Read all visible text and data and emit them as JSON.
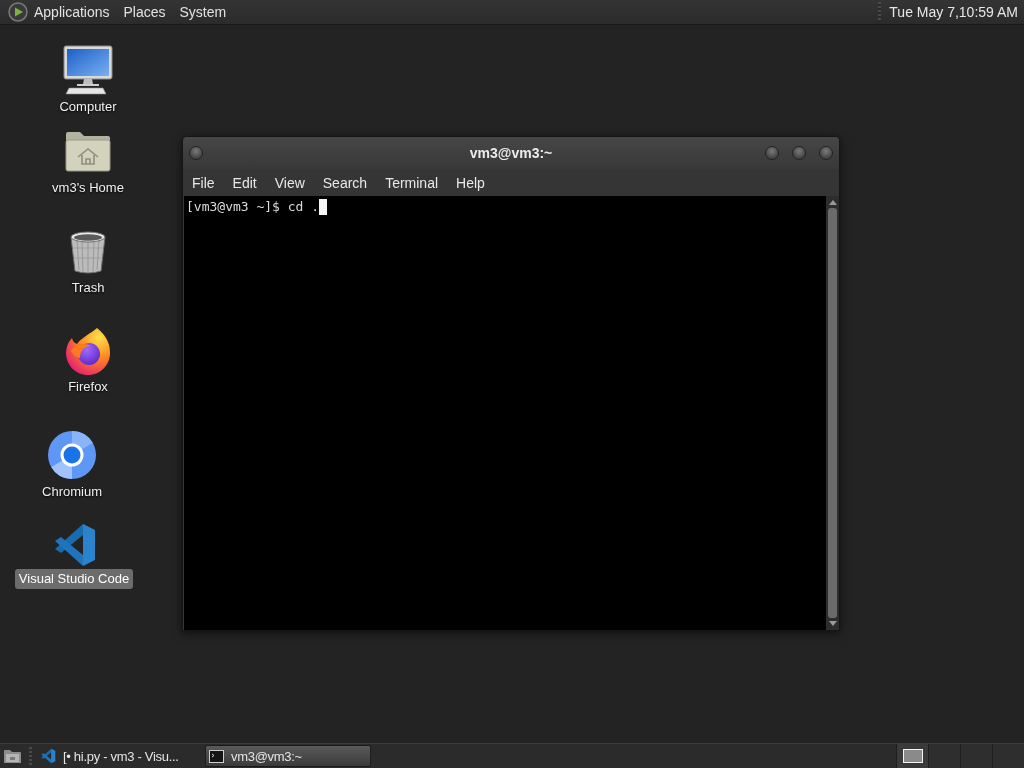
{
  "top_panel": {
    "menus": [
      "Applications",
      "Places",
      "System"
    ],
    "clock": "Tue May 7,10:59 AM"
  },
  "desktop_icons": [
    {
      "label": "Computer",
      "kind": "computer",
      "selected": false
    },
    {
      "label": "vm3's Home",
      "kind": "home",
      "selected": false
    },
    {
      "label": "Trash",
      "kind": "trash",
      "selected": false
    },
    {
      "label": "Firefox",
      "kind": "firefox",
      "selected": false
    },
    {
      "label": "Chromium",
      "kind": "chromium",
      "selected": false
    },
    {
      "label": "Visual Studio Code",
      "kind": "vscode",
      "selected": true
    }
  ],
  "terminal_window": {
    "title": "vm3@vm3:~",
    "menu": [
      "File",
      "Edit",
      "View",
      "Search",
      "Terminal",
      "Help"
    ],
    "lines": [
      "[vm3@vm3 ~]$ cd ."
    ]
  },
  "taskbar": {
    "tasks": [
      {
        "label": "[• hi.py - vm3 - Visu...",
        "kind": "vscode",
        "selected": false
      },
      {
        "label": "vm3@vm3:~",
        "kind": "terminal",
        "selected": true
      }
    ],
    "workspaces": [
      {
        "selected": true
      },
      {
        "selected": false
      },
      {
        "selected": false
      },
      {
        "selected": false
      }
    ]
  }
}
